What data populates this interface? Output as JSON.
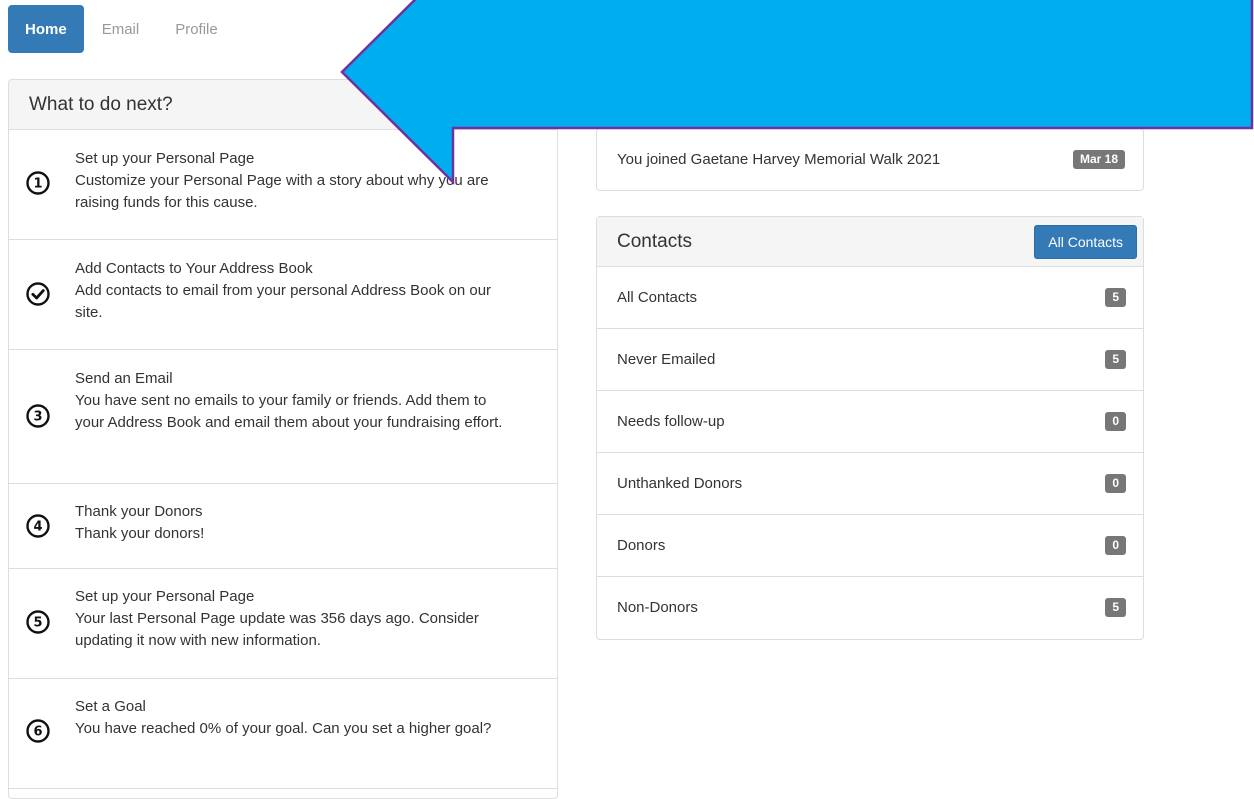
{
  "nav": {
    "tabs": [
      {
        "label": "Home",
        "active": true
      },
      {
        "label": "Email",
        "active": false
      },
      {
        "label": "Profile",
        "active": false
      }
    ]
  },
  "next_steps": {
    "title": "What to do next?",
    "tasks": [
      {
        "number": "1",
        "icon": "number-1-circle-icon",
        "title": "Set up your Personal Page",
        "description": "Customize your Personal Page with a story about why you are raising funds for this cause."
      },
      {
        "number": "",
        "icon": "check-circle-icon",
        "title": "Add Contacts to Your Address Book",
        "description": "Add contacts to email from your personal Address Book on our site."
      },
      {
        "number": "3",
        "icon": "number-3-circle-icon",
        "title": "Send an Email",
        "description": "You have sent no emails to your family or friends. Add them to your Address Book and email them about your fundraising effort."
      },
      {
        "number": "4",
        "icon": "number-4-circle-icon",
        "title": "Thank your Donors",
        "description": "Thank your donors!"
      },
      {
        "number": "5",
        "icon": "number-5-circle-icon",
        "title": "Set up your Personal Page",
        "description": "Your last Personal Page update was 356 days ago. Consider updating it now with new information."
      },
      {
        "number": "6",
        "icon": "number-6-circle-icon",
        "title": "Set a Goal",
        "description": "You have reached 0% of your goal. Can you set a higher goal?"
      }
    ]
  },
  "activity": {
    "text": "You joined Gaetane Harvey Memorial Walk 2021",
    "date": "Mar 18"
  },
  "contacts": {
    "title": "Contacts",
    "button_label": "All Contacts",
    "rows": [
      {
        "label": "All Contacts",
        "count": "5"
      },
      {
        "label": "Never Emailed",
        "count": "5"
      },
      {
        "label": "Needs follow-up",
        "count": "0"
      },
      {
        "label": "Unthanked Donors",
        "count": "0"
      },
      {
        "label": "Donors",
        "count": "0"
      },
      {
        "label": "Non-Donors",
        "count": "5"
      }
    ]
  },
  "colors": {
    "primary": "#337ab7",
    "badge": "#777777",
    "annotation_arrow_fill": "#00aeef",
    "annotation_arrow_stroke": "#7030a0"
  }
}
